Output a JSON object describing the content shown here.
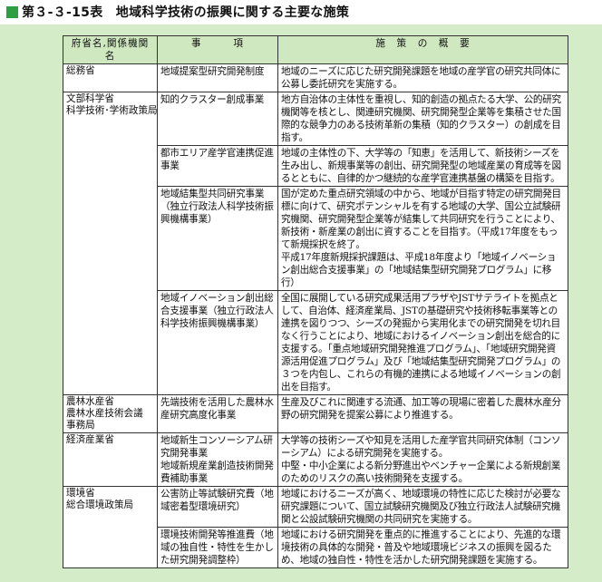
{
  "title": "第３-３-15表　地域科学技術の振興に関する主要な施策",
  "colors": {
    "title_square": "#2e9e43",
    "frame_bg": "#d4ecc8",
    "header_bg": "#cfe8c0"
  },
  "table": {
    "headers": [
      "府省名,関係機関名",
      "事　　　項",
      "施　策　の　概　要"
    ],
    "rows": [
      {
        "org": [
          "総務省"
        ],
        "jikou": "地域提案型研究開発制度",
        "sesaku": [
          "地域のニーズに応じた研究開発課題を地域の産学官の研究共同体に公募し委託研究を実施する。"
        ]
      },
      {
        "org": [
          "文部科学省",
          "科学技術･学術政策局"
        ],
        "jikou": "知的クラスター創成事業",
        "sesaku": [
          "地方自治体の主体性を重視し、知的創造の拠点たる大学、公的研究機関等を核とし、関連研究機関、研究開発型企業等を集積させた国際的な競争力のある技術革新の集積（知的クラスター）の創成を目指す。"
        ]
      },
      {
        "org": [],
        "jikou": "都市エリア産学官連携促進事業",
        "sesaku": [
          "地域の主体性の下、大学等の「知恵」を活用して、新技術シーズを生み出し、新規事業等の創出、研究開発型の地域産業の育成等を図るとともに、自律的かつ継続的な産学官連携基盤の構築を目指す。"
        ]
      },
      {
        "org": [],
        "jikou": "地域結集型共同研究事業（独立行政法人科学技術振興機構事業）",
        "sesaku": [
          "国が定めた重点研究領域の中から、地域が目指す特定の研究開発目標に向けて、研究ポテンシャルを有する地域の大学、国公立試験研究機関、研究開発型企業等が結集して共同研究を行うことにより、新技術・新産業の創出に資することを目指す。（平成17年度をもって新規採択を終了。",
          "平成17年度新規採択課題は、平成18年度より「地域イノベーション創出総合支援事業」の「地域結集型研究開発プログラム」に移行）"
        ]
      },
      {
        "org": [],
        "jikou": "地域イノベーション創出総合支援事業（独立行政法人科学技術振興機構事業）",
        "sesaku": [
          "全国に展開している研究成果活用プラザやJSTサテライトを拠点として、自治体、経済産業局、JSTの基礎研究や技術移転事業等との連携を図りつつ、シーズの発掘から実用化までの研究開発を切れ目なく行うことにより、地域におけるイノベーション創出を総合的に支援する。「重点地域研究開発推進プログラム」、「地域研究開発資源活用促進プログラム」及び「地域結集型研究開発プログラム」の３つを内包し、これらの有機的連携による地域イノベーションの創出を目指す。"
        ]
      },
      {
        "org": [
          "農林水産省",
          "農林水産技術会議",
          "事務局"
        ],
        "jikou": "先端技術を活用した農林水産研究高度化事業",
        "sesaku": [
          "生産及びこれに関連する流通、加工等の現場に密着した農林水産分野の研究開発を提案公募により推進する。"
        ]
      },
      {
        "org": [
          "経済産業省"
        ],
        "jikou": "地域新生コンソーシアム研究開発事業\n地域新規産業創造技術開発費補助事業",
        "sesaku": [
          "大学等の技術シーズや知見を活用した産学官共同研究体制（コンソーシアム）による研究開発を実施する。",
          "中堅・中小企業による新分野進出やベンチャー企業による新規創業のためのリスクの高い技術開発を支援する。"
        ]
      },
      {
        "org": [
          "環境省",
          "総合環境政策局"
        ],
        "jikou": "公害防止等試験研究費（地域密着型環境研究）",
        "sesaku": [
          "地域におけるニーズが高く、地域環境の特性に応じた検討が必要な研究課題について、国立試験研究機関及び独立行政法人試験研究機関と公設試験研究機関の共同研究を実施する。"
        ]
      },
      {
        "org": [],
        "jikou": "環境技術開発等推進費（地域の独自性・特性を生かした研究開発調整枠）",
        "sesaku": [
          "地域における研究開発を重点的に推進することにより、先進的な環境技術の具体的な開発・普及や地域環境ビジネスの振興を図るため、地域の独自性・特性を活かした研究開発課題を実施する。"
        ]
      }
    ]
  }
}
